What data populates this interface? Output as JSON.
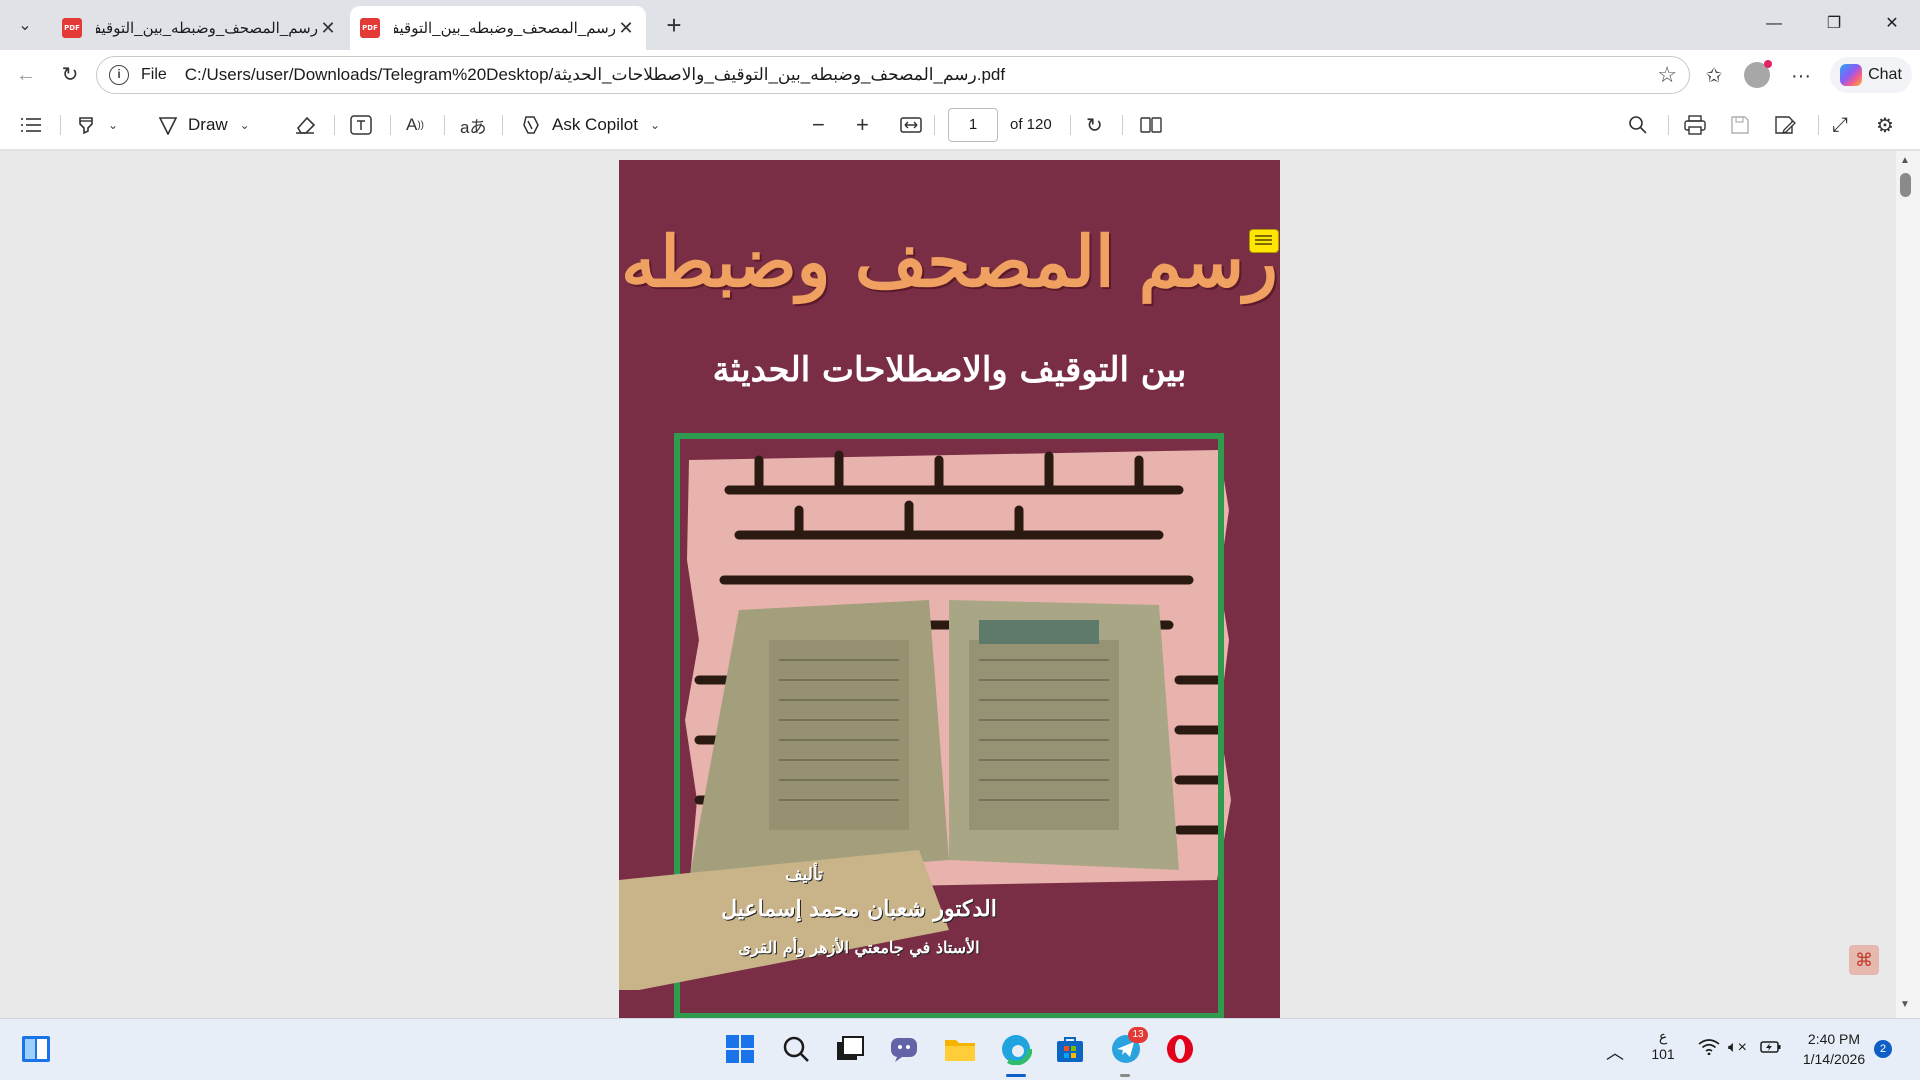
{
  "browser": {
    "tabs": [
      {
        "title": "رسم_المصحف_وضبطه_بين_التوقيف",
        "favicon": "PDF",
        "active": false
      },
      {
        "title": "رسم_المصحف_وضبطه_بين_التوقيف",
        "favicon": "PDF",
        "active": true
      }
    ],
    "address": {
      "scheme_label": "File",
      "url": "C:/Users/user/Downloads/Telegram%20Desktop/رسم_المصحف_وضبطه_بين_التوقيف_والاصطلاحات_الحديثة.pdf"
    },
    "chat_label": "Chat"
  },
  "pdf_toolbar": {
    "draw_label": "Draw",
    "copilot_label": "Ask Copilot",
    "page_current": "1",
    "page_total": "of 120"
  },
  "document": {
    "cover_title": "رسم المصحف وضبطه",
    "cover_subtitle": "بين التوقيف والاصطلاحات الحديثة",
    "author_intro": "تأليف",
    "author_name": "الدكتور شعبان محمد إسماعيل",
    "author_title": "الأستاذ في جامعتي الأزهر وأم القرى",
    "background_color": "#7a2e45",
    "title_color": "#f0a060"
  },
  "taskbar": {
    "language": "ع",
    "language_code": "101",
    "time": "2:40 PM",
    "date": "1/14/2026",
    "notification_count": "2",
    "telegram_badge": "13"
  }
}
